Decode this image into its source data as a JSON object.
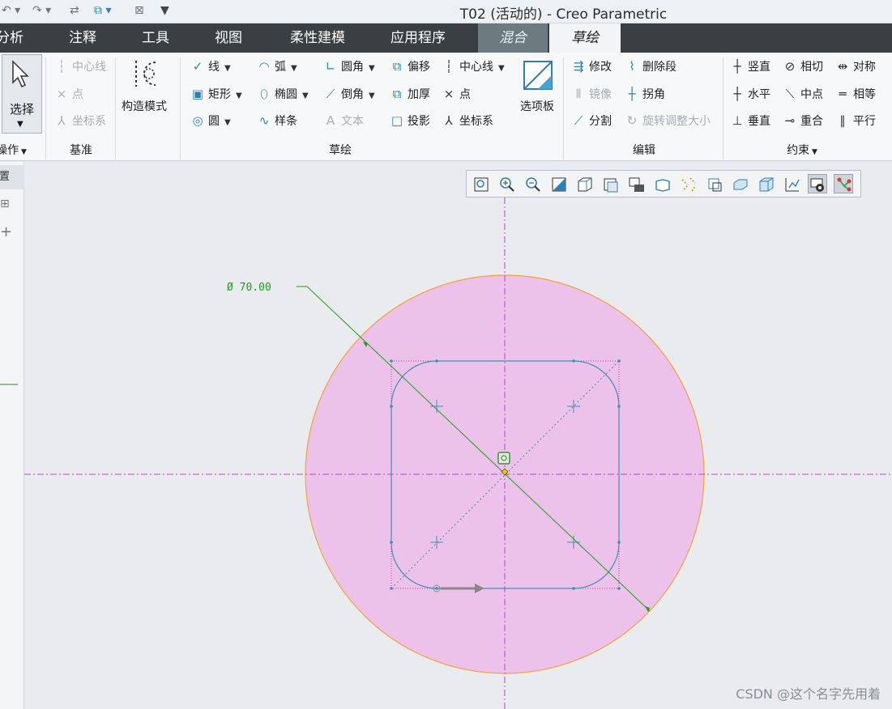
{
  "window": {
    "title": "T02 (活动的) - Creo Parametric"
  },
  "tabs": [
    "分析",
    "注释",
    "工具",
    "视图",
    "柔性建模",
    "应用程序",
    "混合",
    "草绘"
  ],
  "ribbon": {
    "select_label": "选择",
    "operations_label": "操作",
    "datum": {
      "centerline": "中心线",
      "point": "点",
      "csys": "坐标系",
      "label": "基准"
    },
    "construction_mode": "构造模式",
    "sketch": {
      "line": "线",
      "arc": "弧",
      "fillet": "圆角",
      "offset": "偏移",
      "centerline": "中心线",
      "rectangle": "矩形",
      "ellipse": "椭圆",
      "chamfer": "倒角",
      "thicken": "加厚",
      "point": "点",
      "circle": "圆",
      "spline": "样条",
      "text": "文本",
      "project": "投影",
      "csys": "坐标系",
      "palette": "选项板",
      "label": "草绘"
    },
    "edit": {
      "modify": "修改",
      "delete_segment": "删除段",
      "mirror": "镜像",
      "corner": "拐角",
      "divide": "分割",
      "rotate_resize": "旋转调整大小",
      "label": "编辑"
    },
    "constrain": {
      "vertical": "竖直",
      "tangent": "相切",
      "symmetric": "对称",
      "horizontal": "水平",
      "midpoint": "中点",
      "equal": "相等",
      "perpendicular": "垂直",
      "coincident": "重合",
      "parallel": "平行",
      "label": "约束"
    }
  },
  "left_panel": {
    "tab_label": "放置"
  },
  "sketch": {
    "dimension_text": "Ø 70.00"
  },
  "colors": {
    "circle_fill": "#ecc2ea",
    "circle_edge": "#f5a13c",
    "centerline": "#b04ec8",
    "dimension": "#1aa01a",
    "geometry": "#3f8fb0"
  },
  "watermark": "CSDN @这个名字先用着"
}
